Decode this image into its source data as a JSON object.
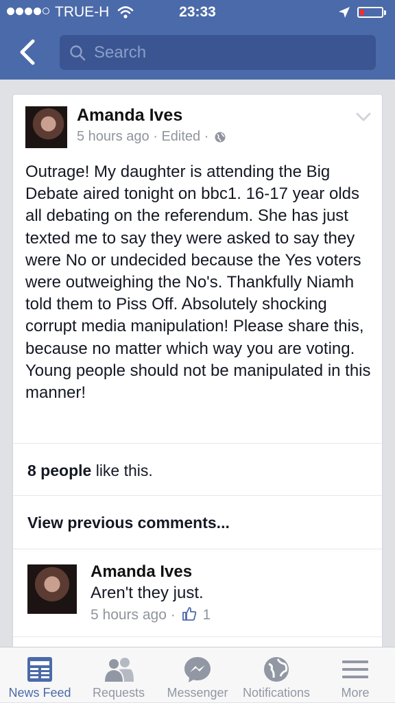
{
  "status_bar": {
    "carrier": "TRUE-H",
    "time": "23:33"
  },
  "search": {
    "placeholder": "Search"
  },
  "post": {
    "author": "Amanda Ives",
    "time": "5 hours ago",
    "edited": "Edited",
    "separator": "·",
    "text": "Outrage! My daughter is attending the Big Debate aired tonight on bbc1. 16-17 year olds all debating on the referendum. She has just texted me to say they were asked to say they were No or undecided because the Yes voters were outweighing the No's. Thankfully Niamh told them to Piss Off. Absolutely shocking  corrupt media manipulation!  Please share this, because no matter which way you are voting. Young people should not be manipulated in this manner!",
    "likes_count": "8 people",
    "likes_suffix": " like this.",
    "view_previous": "View previous comments..."
  },
  "comment": {
    "author": "Amanda Ives",
    "text": "Aren't they just.",
    "time": "5 hours ago",
    "separator": "·",
    "like_count": "1"
  },
  "tabs": [
    {
      "label": "News Feed",
      "icon": "news-feed-icon",
      "active": true
    },
    {
      "label": "Requests",
      "icon": "friend-requests-icon",
      "active": false
    },
    {
      "label": "Messenger",
      "icon": "messenger-icon",
      "active": false
    },
    {
      "label": "Notifications",
      "icon": "globe-icon",
      "active": false
    },
    {
      "label": "More",
      "icon": "menu-icon",
      "active": false
    }
  ],
  "colors": {
    "header": "#4b6aa9",
    "search_field": "#3a5592",
    "active_tab": "#4b6aa9",
    "battery_low": "#ff2a2a"
  }
}
